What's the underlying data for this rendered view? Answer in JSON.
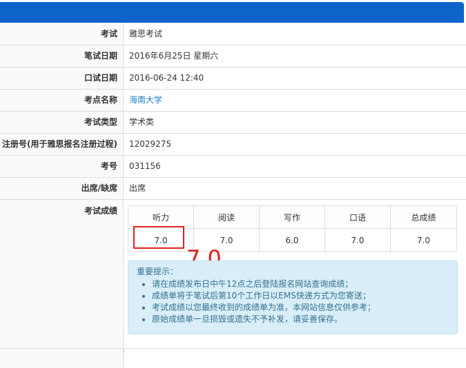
{
  "rows": [
    {
      "label": "考试",
      "value": "雅思考试"
    },
    {
      "label": "笔试日期",
      "value": "2016年6月25日 星期六"
    },
    {
      "label": "口试日期",
      "value": "2016-06-24 12:40"
    },
    {
      "label": "考点名称",
      "value": "海南大学"
    },
    {
      "label": "考试类型",
      "value": "学术类"
    },
    {
      "label": "注册号(用于雅思报名注册过程)",
      "value": "12029275"
    },
    {
      "label": "考号",
      "value": "031156"
    },
    {
      "label": "出席/缺席",
      "value": "出席"
    }
  ],
  "score": {
    "label": "考试成绩",
    "headers": [
      "听力",
      "阅读",
      "写作",
      "口语",
      "总成绩"
    ],
    "values": [
      "7.0",
      "7.0",
      "6.0",
      "7.0",
      "7.0"
    ]
  },
  "annotation": "7.0",
  "notice": {
    "title": "重要提示：",
    "items": [
      "请在成绩发布日中午12点之后登陆报名网站查询成绩；",
      "成绩单将于笔试后第10个工作日以EMS快递方式为您寄送；",
      "考试成绩以您最终收到的成绩单为准，本网站信息仅供参考；",
      "原始成绩单一旦损毁或遗失不予补发，请妥善保存。"
    ]
  },
  "colors": {
    "header_bar": "#0d63c9",
    "highlight": "#e02020",
    "notice_bg": "#d9eef8",
    "link": "#1f7fc4"
  }
}
